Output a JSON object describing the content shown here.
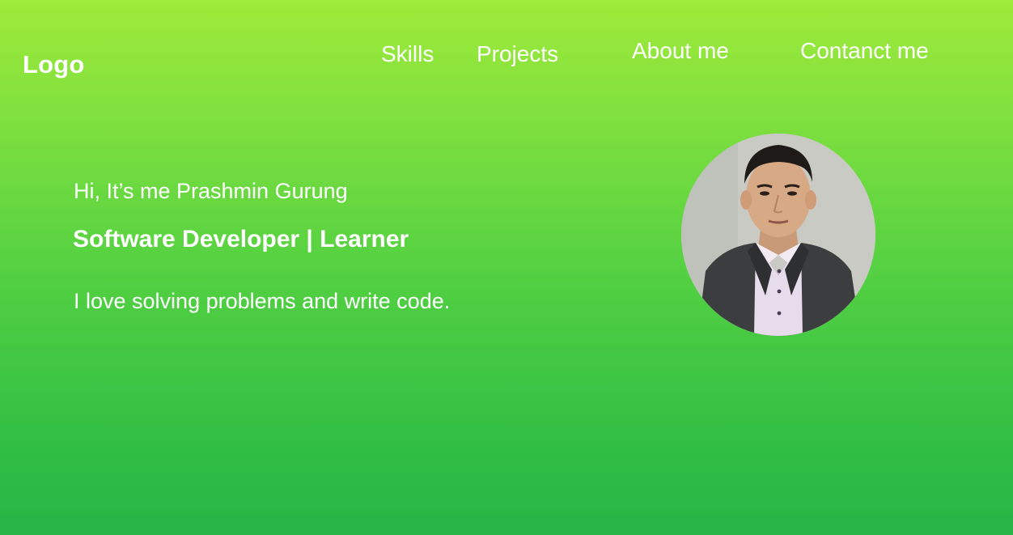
{
  "header": {
    "logo": "Logo",
    "nav": {
      "skills": "Skills",
      "projects": "Projects",
      "about": "About me",
      "contact": "Contanct me"
    }
  },
  "hero": {
    "greeting": "Hi, It’s me Prashmin Gurung",
    "role": "Software Developer | Learner",
    "tagline": "I love solving problems and write code."
  },
  "profile": {
    "image": "portrait-photo"
  },
  "colors": {
    "gradient_top": "#a0ea3a",
    "gradient_bottom": "#26b546",
    "text": "#ffffff"
  }
}
